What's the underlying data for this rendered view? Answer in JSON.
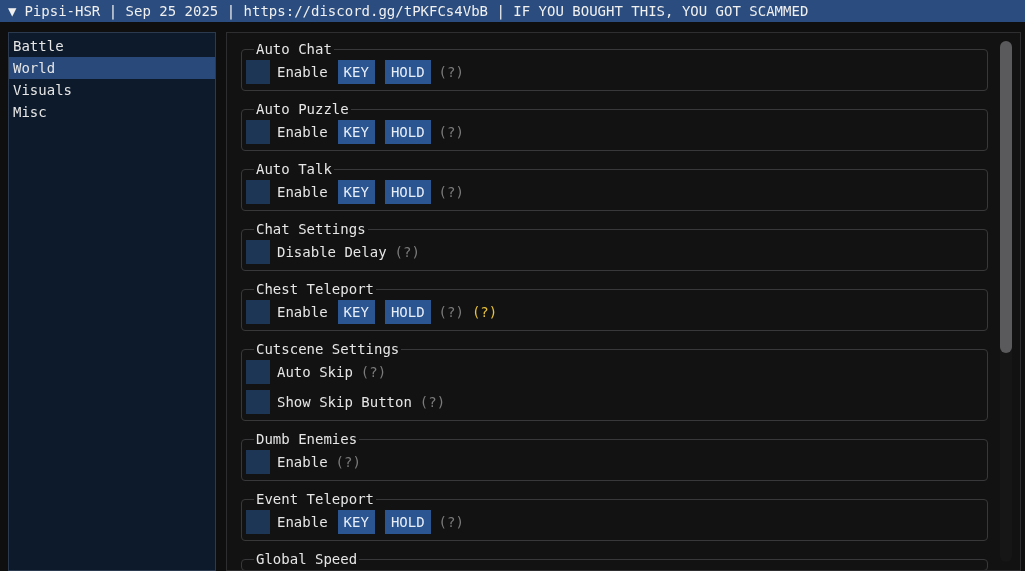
{
  "window": {
    "collapse_glyph": "▼",
    "title": "Pipsi-HSR | Sep 25 2025 | https://discord.gg/tPKFCs4VbB | IF YOU BOUGHT THIS, YOU GOT SCAMMED"
  },
  "sidebar": {
    "items": [
      {
        "label": "Battle",
        "selected": false
      },
      {
        "label": "World",
        "selected": true
      },
      {
        "label": "Visuals",
        "selected": false
      },
      {
        "label": "Misc",
        "selected": false
      }
    ]
  },
  "groups": [
    {
      "title": "Auto Chat",
      "rows": [
        {
          "label": "Enable",
          "checked": false,
          "buttons": [
            "KEY",
            "HOLD"
          ],
          "hints": [
            {
              "text": "(?)",
              "kind": "normal"
            }
          ]
        }
      ]
    },
    {
      "title": "Auto Puzzle",
      "rows": [
        {
          "label": "Enable",
          "checked": false,
          "buttons": [
            "KEY",
            "HOLD"
          ],
          "hints": [
            {
              "text": "(?)",
              "kind": "normal"
            }
          ]
        }
      ]
    },
    {
      "title": "Auto Talk",
      "rows": [
        {
          "label": "Enable",
          "checked": false,
          "buttons": [
            "KEY",
            "HOLD"
          ],
          "hints": [
            {
              "text": "(?)",
              "kind": "normal"
            }
          ]
        }
      ]
    },
    {
      "title": "Chat Settings",
      "rows": [
        {
          "label": "Disable Delay",
          "checked": false,
          "hints": [
            {
              "text": "(?)",
              "kind": "normal"
            }
          ]
        }
      ]
    },
    {
      "title": "Chest Teleport",
      "rows": [
        {
          "label": "Enable",
          "checked": false,
          "buttons": [
            "KEY",
            "HOLD"
          ],
          "hints": [
            {
              "text": "(?)",
              "kind": "normal"
            },
            {
              "text": "(?)",
              "kind": "warning"
            }
          ]
        }
      ]
    },
    {
      "title": "Cutscene Settings",
      "rows": [
        {
          "label": "Auto Skip",
          "checked": false,
          "hints": [
            {
              "text": "(?)",
              "kind": "normal"
            }
          ]
        },
        {
          "label": "Show Skip Button",
          "checked": false,
          "hints": [
            {
              "text": "(?)",
              "kind": "normal"
            }
          ]
        }
      ]
    },
    {
      "title": "Dumb Enemies",
      "rows": [
        {
          "label": "Enable",
          "checked": false,
          "hints": [
            {
              "text": "(?)",
              "kind": "normal"
            }
          ]
        }
      ]
    },
    {
      "title": "Event Teleport",
      "rows": [
        {
          "label": "Enable",
          "checked": false,
          "buttons": [
            "KEY",
            "HOLD"
          ],
          "hints": [
            {
              "text": "(?)",
              "kind": "normal"
            }
          ]
        }
      ]
    },
    {
      "title": "Global Speed"
    }
  ]
}
